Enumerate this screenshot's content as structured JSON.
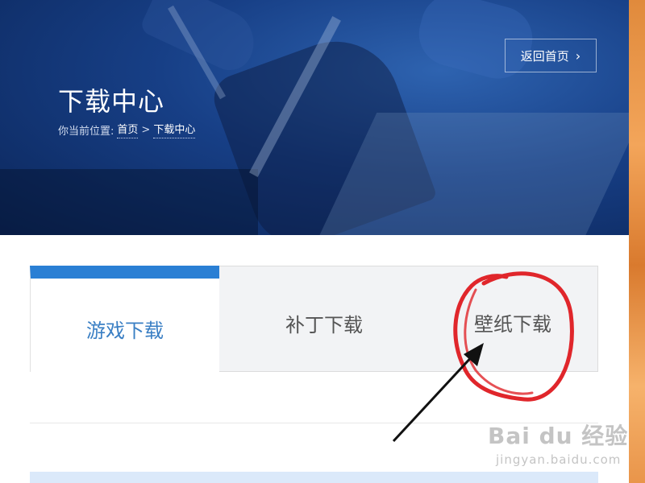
{
  "hero": {
    "title": "下载中心",
    "breadcrumb": {
      "prefix": "你当前位置:",
      "home": "首页",
      "separator": ">",
      "current": "下载中心"
    },
    "back_button": {
      "label": "返回首页",
      "icon": "chevron-right-icon"
    }
  },
  "tabs": [
    {
      "label": "游戏下载",
      "active": true
    },
    {
      "label": "补丁下载",
      "active": false
    },
    {
      "label": "壁纸下载",
      "active": false
    }
  ],
  "colors": {
    "accent": "#2a7fd4",
    "active_tab_text": "#3a7fc4",
    "annotation_red": "#e0262b"
  },
  "watermark": {
    "brand": "Bai du 经验",
    "url": "jingyan.baidu.com"
  }
}
